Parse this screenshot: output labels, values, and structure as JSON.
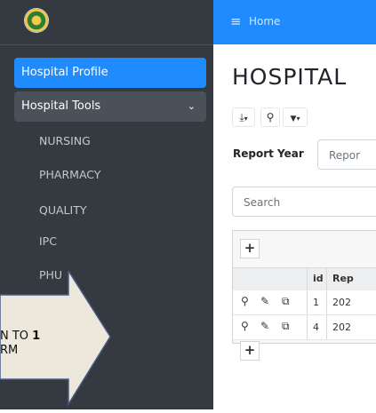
{
  "topbar": {
    "menu_icon": "≡",
    "home_label": "Home"
  },
  "sidebar": {
    "active_item": "Hospital Profile",
    "group_label": "Hospital Tools",
    "group_chevron": "⌄",
    "items": [
      "NURSING",
      "PHARMACY",
      "QUALITY",
      "IPC",
      "PHU"
    ]
  },
  "main": {
    "title": "HOSPITAL",
    "toolbar": {
      "download_icon": "⤓",
      "search_icon": "⚲",
      "filter_icon": "▼"
    },
    "report_year_label": "Report Year",
    "report_year_placeholder": "Repor",
    "search_placeholder": "Search",
    "add_label": "+",
    "columns": [
      "id",
      "Rep"
    ],
    "rows": [
      {
        "id": "1",
        "rep": "202"
      },
      {
        "id": "4",
        "rep": "202"
      }
    ]
  },
  "callout": {
    "line1_prefix": "N TO ",
    "line1_bold": "1",
    "line2": "RM"
  }
}
